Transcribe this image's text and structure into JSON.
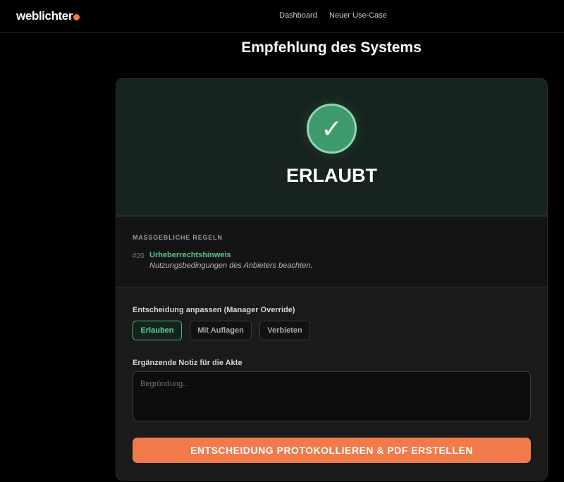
{
  "header": {
    "logo_text": "weblichter",
    "nav": [
      "Dashboard",
      "Neuer Use-Case"
    ],
    "accent_color": "#f07a4a"
  },
  "page": {
    "title": "Empfehlung des Systems"
  },
  "result": {
    "icon": "checkmark-icon",
    "icon_glyph": "✓",
    "verdict": "ERLAUBT",
    "status_color": "#3f9a6c"
  },
  "rules": {
    "label": "MASSGEBLICHE REGELN",
    "items": [
      {
        "number": "#20",
        "title": "Urheberrechtshinweis",
        "description": "Nutzungsbedingungen des Anbieters beachten."
      }
    ]
  },
  "override": {
    "label": "Entscheidung anpassen (Manager Override)",
    "options": [
      "Erlauben",
      "Mit Auflagen",
      "Verbieten"
    ],
    "selected": "Erlauben"
  },
  "note": {
    "label": "Ergänzende Notiz für die Akte",
    "placeholder": "Begründung...",
    "value": ""
  },
  "submit": {
    "label": "ENTSCHEIDUNG PROTOKOLLIEREN & PDF ERSTELLEN"
  }
}
